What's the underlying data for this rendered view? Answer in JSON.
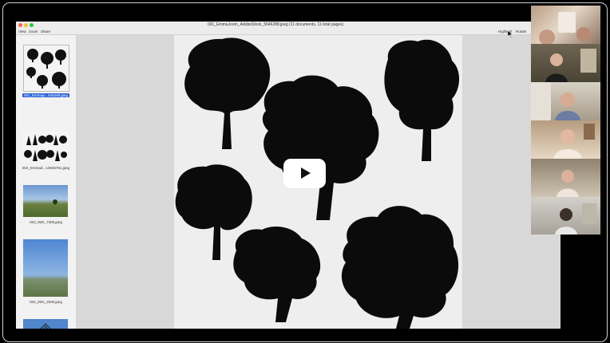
{
  "window": {
    "title": "001_EmmaJoom_AdobeStock_5646288.jpeg (11 documents, 11 total pages)",
    "menu": [
      "View",
      "Zoom",
      "Share"
    ],
    "toolbar_right": [
      "Highlight",
      "Rotate"
    ]
  },
  "sidebar": {
    "thumbnails": [
      {
        "label": "001_Emmajo...646288.jpeg",
        "selected": true
      },
      {
        "label": "002_EmmaZ...13945781.jpeg",
        "selected": false
      },
      {
        "label": "003_IMG_7305.jpeg",
        "selected": false
      },
      {
        "label": "004_IMG_2506.jpeg",
        "selected": false
      }
    ]
  },
  "player": {
    "play_icon": "play-icon"
  },
  "colors": {
    "selection": "#2962d9",
    "window_bg": "#e8e8e8",
    "page_bg": "#eeeeee"
  }
}
